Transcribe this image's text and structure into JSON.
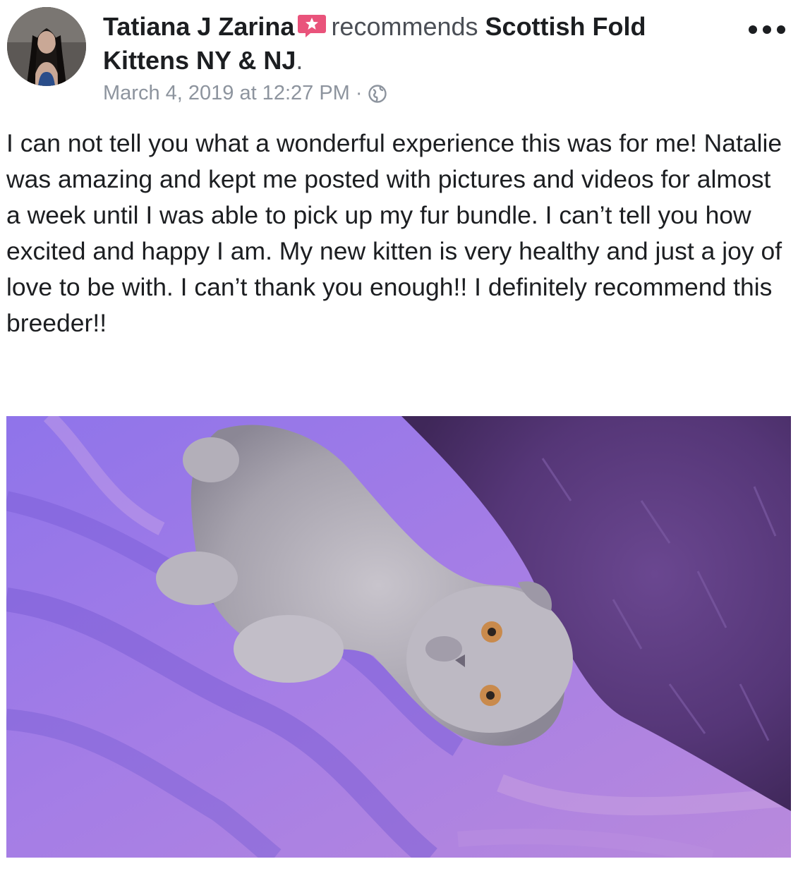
{
  "post": {
    "author": "Tatiana J Zarina",
    "recommends_text": "recommends",
    "page_name": "Scottish Fold Kittens NY & NJ",
    "page_name_suffix": ".",
    "timestamp": "March 4, 2019 at 12:27 PM",
    "meta_separator": "·",
    "privacy_icon": "globe-icon",
    "recommend_icon": "star-badge-icon",
    "more_icon": "more-dots-icon",
    "body": "I can not tell you what a wonderful experience this was for me! Natalie was amazing and kept me posted with pictures and videos for almost a week until I was able to pick up my fur bundle. I can’t tell you how excited and happy I am. My new kitten is very healthy and just a joy of love to be with. I can’t thank you enough!! I definitely recommend this breeder!!"
  },
  "colors": {
    "recommend_badge": "#e9537b",
    "text_primary": "#1c1e21",
    "text_secondary": "#8d949e",
    "blanket": "#9b7ae6",
    "pillow": "#5b3a78"
  }
}
